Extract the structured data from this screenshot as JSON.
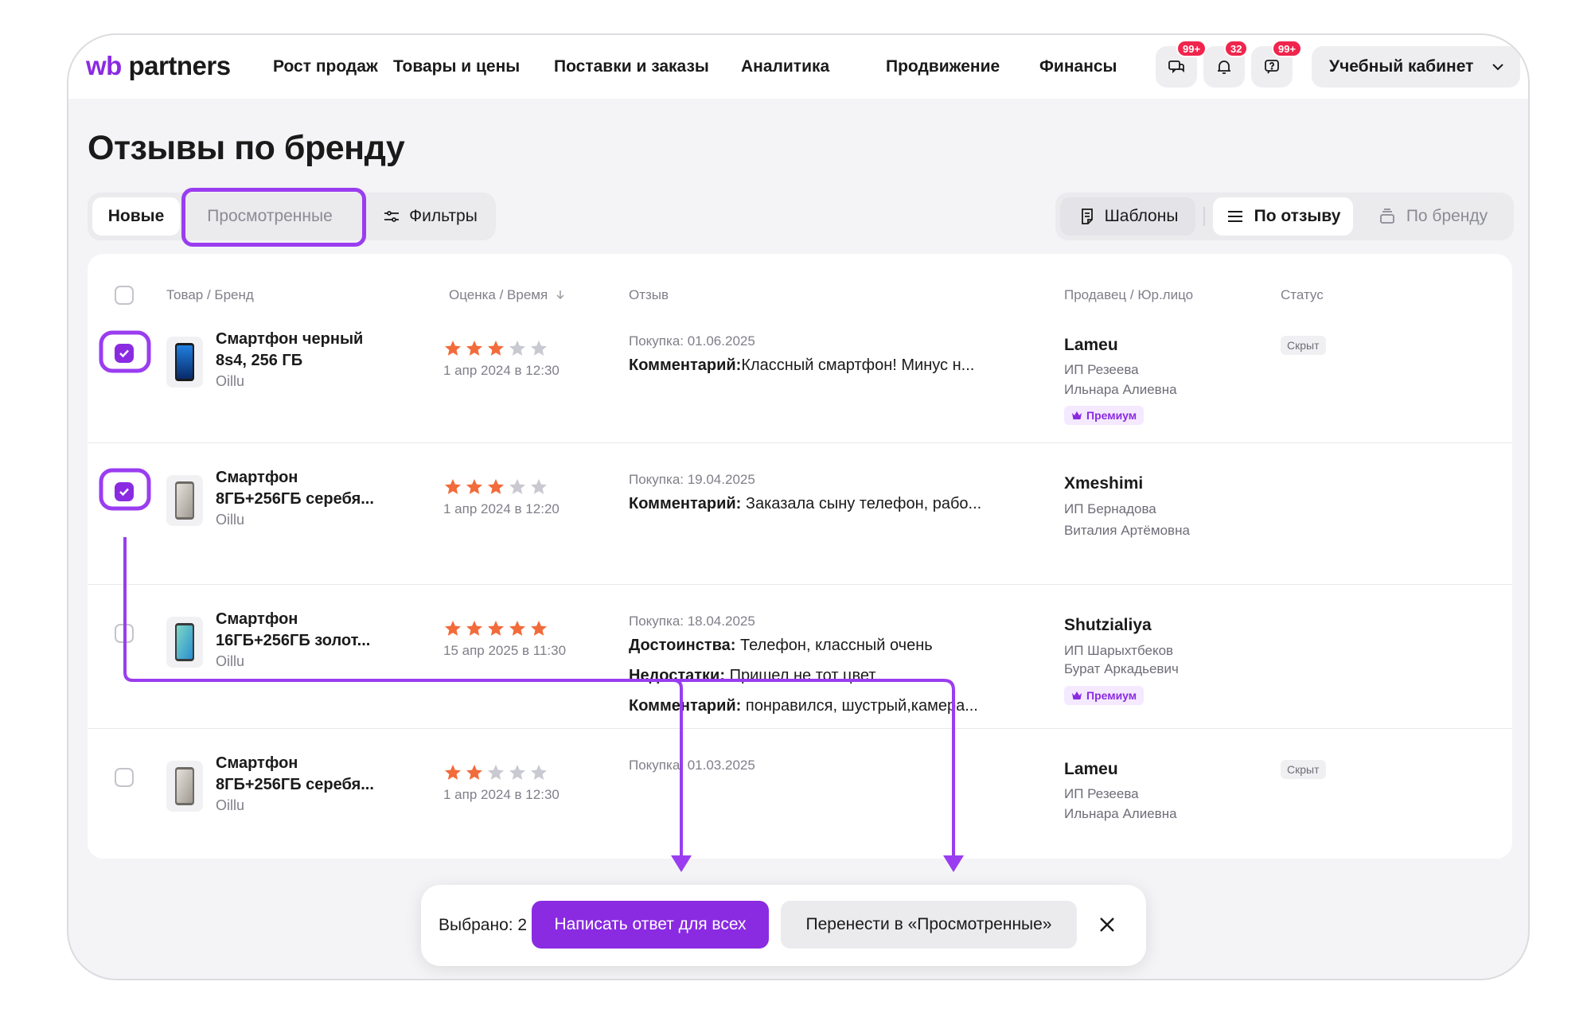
{
  "header": {
    "logo_wb": "wb",
    "logo_partners": "partners",
    "nav": [
      "Рост продаж",
      "Товары и цены",
      "Поставки и заказы",
      "Аналитика",
      "Продвижение",
      "Финансы"
    ],
    "icons": [
      {
        "name": "chat-icon",
        "badge": "99+"
      },
      {
        "name": "bell-icon",
        "badge": "32"
      },
      {
        "name": "support-icon",
        "badge": "99+"
      }
    ],
    "cabinet_label": "Учебный кабинет"
  },
  "page_title": "Отзывы по бренду",
  "tabs": {
    "new": "Новые",
    "viewed": "Просмотренные",
    "filters": "Фильтры",
    "templates": "Шаблоны",
    "by_review": "По отзыву",
    "by_brand": "По бренду"
  },
  "table": {
    "headers": {
      "product": "Товар / Бренд",
      "rating": "Оценка / Время",
      "review": "Отзыв",
      "seller": "Продавец / Юр.лицо",
      "status": "Статус"
    },
    "rows": [
      {
        "checked": true,
        "name_line1": "Смартфон черный",
        "name_line2": "8s4, 256 ГБ",
        "brand": "Oillu",
        "rating": 3,
        "time": "1 апр 2024 в 12:30",
        "purchase": "Покупка: 01.06.2025",
        "lines": [
          {
            "label": "Комментарий:",
            "text": "Классный смартфон! Минус н..."
          }
        ],
        "seller": "Lameu",
        "entity_line1": "ИП Резеева",
        "entity_line2": "Ильнара Алиевна",
        "premium": "Премиум",
        "status": "Скрыт"
      },
      {
        "checked": true,
        "name_line1": "Смартфон",
        "name_line2": "8ГБ+256ГБ серебя...",
        "brand": "Oillu",
        "rating": 3,
        "time": "1 апр 2024 в 12:20",
        "purchase": "Покупка: 19.04.2025",
        "lines": [
          {
            "label": "Комментарий:",
            "text": " Заказала сыну телефон, рабо..."
          }
        ],
        "seller": "Xmeshimi",
        "entity_line1": "ИП Бернадова",
        "entity_line2": "Виталия Артёмовна",
        "premium": "",
        "status": ""
      },
      {
        "checked": false,
        "name_line1": "Смартфон",
        "name_line2": "16ГБ+256ГБ золот...",
        "brand": "Oillu",
        "rating": 5,
        "time": "15 апр 2025 в 11:30",
        "purchase": "Покупка: 18.04.2025",
        "lines": [
          {
            "label": "Достоинства:",
            "text": " Телефон, классный очень"
          },
          {
            "label": "Недостатки:",
            "text": " Пришел не тот цвет"
          },
          {
            "label": "Комментарий:",
            "text": " понравился, шустрый,камера..."
          }
        ],
        "seller": "Shutzialiya",
        "entity_line1": "ИП Шарыхтбеков",
        "entity_line2": "Бурат Аркадьевич",
        "premium": "Премиум",
        "status": ""
      },
      {
        "checked": false,
        "name_line1": "Смартфон",
        "name_line2": "8ГБ+256ГБ серебя...",
        "brand": "Oillu",
        "rating": 2,
        "time": "1 апр 2024 в 12:30",
        "purchase": "Покупка: 01.03.2025",
        "lines": [],
        "seller": "Lameu",
        "entity_line1": "ИП Резеева",
        "entity_line2": "Ильнара Алиевна",
        "premium": "",
        "status": "Скрыт"
      }
    ]
  },
  "action_bar": {
    "selected": "Выбрано: 2",
    "primary": "Написать ответ для всех",
    "secondary": "Перенести в «Просмотренные»"
  },
  "colors": {
    "accent": "#8a2be2",
    "highlight": "#9a3df0",
    "star_on": "#f26b3a",
    "star_off": "#c9c9d1",
    "badge": "#f0254d"
  }
}
